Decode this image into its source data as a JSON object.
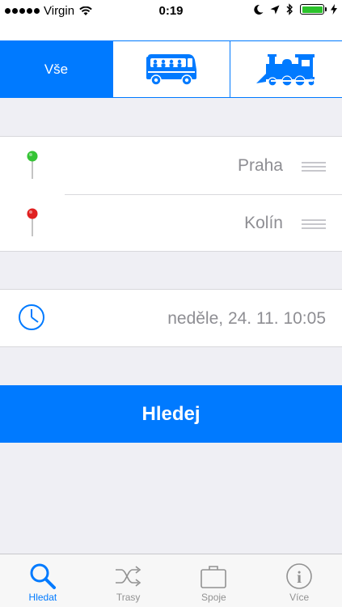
{
  "status_bar": {
    "carrier": "Virgin",
    "time": "0:19",
    "battery_percent": 100
  },
  "transport_filter": {
    "all_label": "Vše",
    "selected": "all",
    "options": [
      "all",
      "bus-icon",
      "train-icon"
    ]
  },
  "route": {
    "from": "Praha",
    "to": "Kolín",
    "from_pin_color": "#35c435",
    "to_pin_color": "#e02020"
  },
  "datetime": {
    "value": "neděle, 24. 11. 10:05"
  },
  "search_button": {
    "label": "Hledej"
  },
  "tab_bar": {
    "items": [
      {
        "label": "Hledat",
        "icon": "magnifier-icon",
        "active": true
      },
      {
        "label": "Trasy",
        "icon": "shuffle-icon",
        "active": false
      },
      {
        "label": "Spoje",
        "icon": "briefcase-icon",
        "active": false
      },
      {
        "label": "Více",
        "icon": "info-icon",
        "active": false
      }
    ]
  },
  "colors": {
    "accent": "#007aff",
    "background": "#efeff4",
    "secondary_text": "#8e8e93"
  }
}
